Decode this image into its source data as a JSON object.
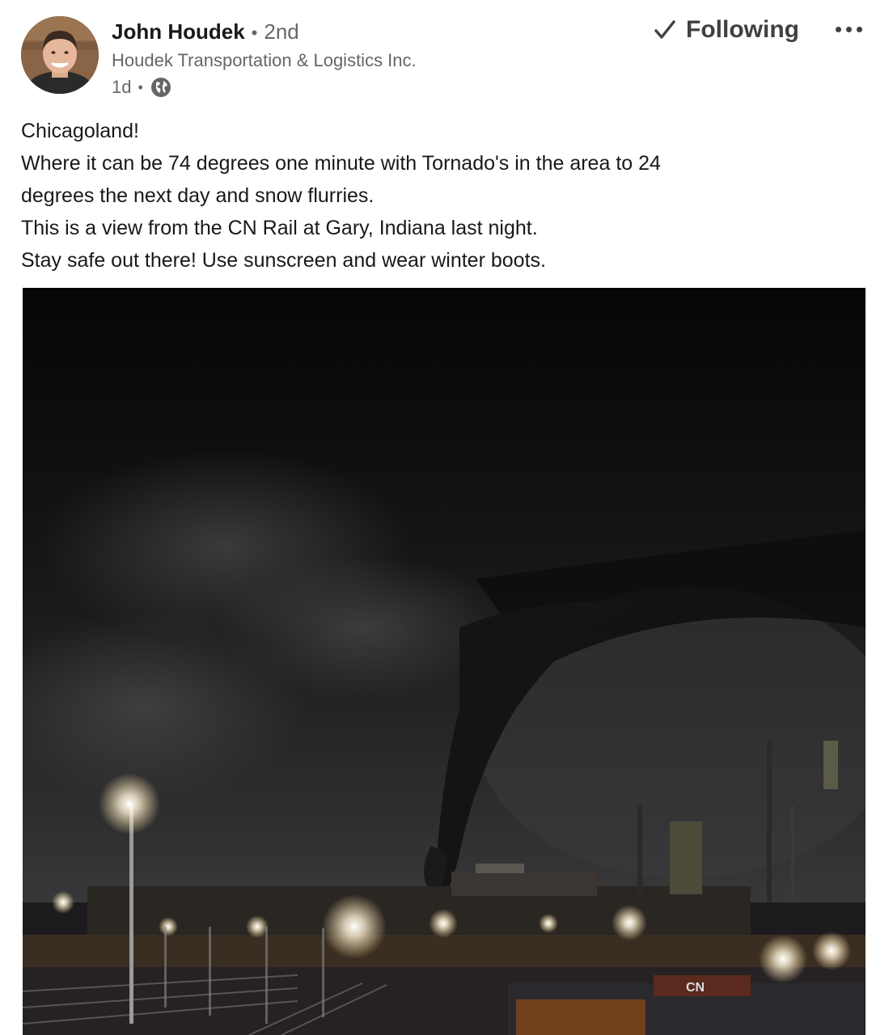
{
  "author": {
    "name": "John Houdek",
    "degree": "2nd",
    "headline": "Houdek Transportation & Logistics Inc.",
    "time_ago": "1d",
    "visibility_icon": "globe-icon",
    "avatar_icon": "avatar-photo"
  },
  "actions": {
    "follow_label": "Following",
    "follow_icon": "check-icon",
    "more_icon": "ellipsis-icon"
  },
  "post": {
    "lines": [
      "Chicagoland!",
      "Where it can be 74 degrees one minute with Tornado's in the area to 24",
      "degrees the next day and snow flurries.",
      "This is a view from the CN Rail at Gary, Indiana last night.",
      "Stay safe out there! Use sunscreen and wear winter boots."
    ],
    "image_description_icon": "tornado-photo",
    "image_text": "CN"
  },
  "colors": {
    "text_primary": "#191919",
    "text_secondary": "#666666",
    "button_text": "#404040",
    "background": "#ffffff"
  }
}
